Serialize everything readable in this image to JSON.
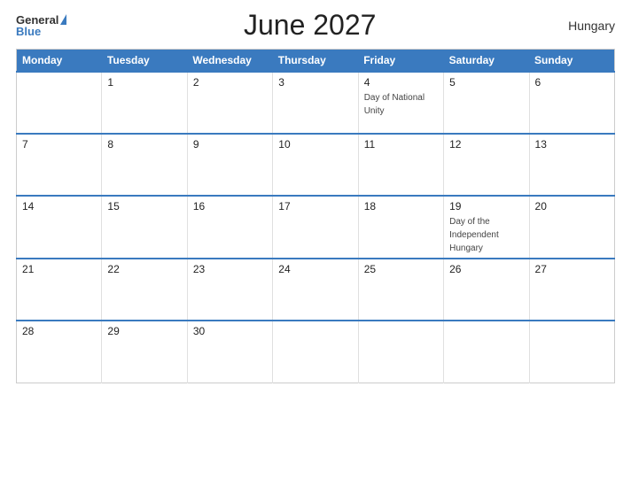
{
  "header": {
    "logo_general": "General",
    "logo_blue": "Blue",
    "title": "June 2027",
    "country": "Hungary"
  },
  "columns": [
    "Monday",
    "Tuesday",
    "Wednesday",
    "Thursday",
    "Friday",
    "Saturday",
    "Sunday"
  ],
  "weeks": [
    [
      {
        "day": "",
        "event": ""
      },
      {
        "day": "1",
        "event": ""
      },
      {
        "day": "2",
        "event": ""
      },
      {
        "day": "3",
        "event": ""
      },
      {
        "day": "4",
        "event": "Day of National Unity"
      },
      {
        "day": "5",
        "event": ""
      },
      {
        "day": "6",
        "event": ""
      }
    ],
    [
      {
        "day": "7",
        "event": ""
      },
      {
        "day": "8",
        "event": ""
      },
      {
        "day": "9",
        "event": ""
      },
      {
        "day": "10",
        "event": ""
      },
      {
        "day": "11",
        "event": ""
      },
      {
        "day": "12",
        "event": ""
      },
      {
        "day": "13",
        "event": ""
      }
    ],
    [
      {
        "day": "14",
        "event": ""
      },
      {
        "day": "15",
        "event": ""
      },
      {
        "day": "16",
        "event": ""
      },
      {
        "day": "17",
        "event": ""
      },
      {
        "day": "18",
        "event": ""
      },
      {
        "day": "19",
        "event": "Day of the Independent Hungary"
      },
      {
        "day": "20",
        "event": ""
      }
    ],
    [
      {
        "day": "21",
        "event": ""
      },
      {
        "day": "22",
        "event": ""
      },
      {
        "day": "23",
        "event": ""
      },
      {
        "day": "24",
        "event": ""
      },
      {
        "day": "25",
        "event": ""
      },
      {
        "day": "26",
        "event": ""
      },
      {
        "day": "27",
        "event": ""
      }
    ],
    [
      {
        "day": "28",
        "event": ""
      },
      {
        "day": "29",
        "event": ""
      },
      {
        "day": "30",
        "event": ""
      },
      {
        "day": "",
        "event": ""
      },
      {
        "day": "",
        "event": ""
      },
      {
        "day": "",
        "event": ""
      },
      {
        "day": "",
        "event": ""
      }
    ]
  ]
}
